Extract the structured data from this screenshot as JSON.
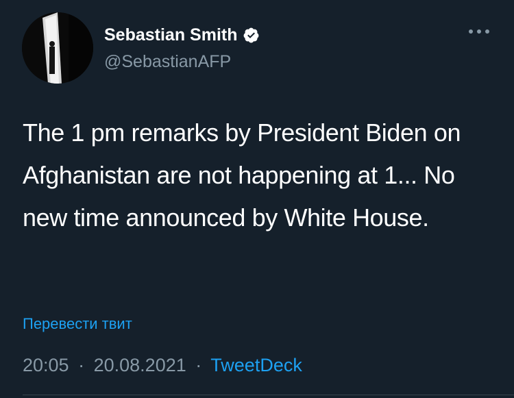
{
  "author": {
    "display_name": "Sebastian Smith",
    "handle": "@SebastianAFP",
    "verified": true
  },
  "tweet": {
    "text": "The 1 pm remarks by President Biden on Afghanistan are not happening at 1... No new time announced by White House."
  },
  "translate_label": "Перевести твит",
  "meta": {
    "time": "20:05",
    "separator": "·",
    "date": "20.08.2021",
    "source": "TweetDeck"
  },
  "icons": {
    "verified": "verified-badge-icon",
    "more": "more-dots-icon"
  },
  "colors": {
    "background": "#15202b",
    "text": "#ffffff",
    "secondary_text": "#8899a6",
    "accent": "#1da1f2",
    "divider": "#38444d"
  }
}
